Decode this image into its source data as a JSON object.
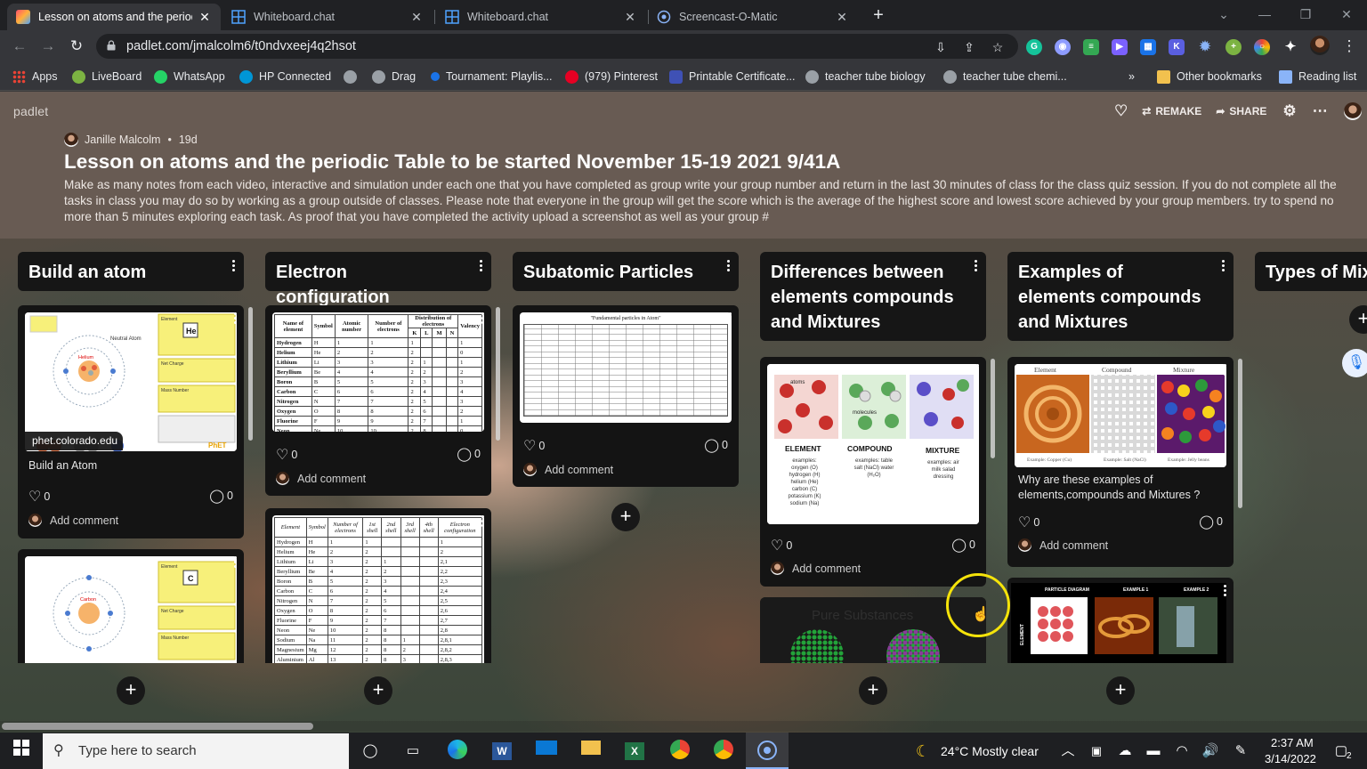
{
  "browser": {
    "tabs": [
      {
        "title": "Lesson on atoms and the periodic",
        "active": true
      },
      {
        "title": "Whiteboard.chat",
        "active": false
      },
      {
        "title": "Whiteboard.chat",
        "active": false
      },
      {
        "title": "Screencast-O-Matic",
        "active": false
      }
    ],
    "url": "padlet.com/jmalcolm6/t0ndvxeej4q2hsot",
    "bookmarks": [
      {
        "label": "Apps"
      },
      {
        "label": "LiveBoard"
      },
      {
        "label": "WhatsApp"
      },
      {
        "label": "HP Connected"
      },
      {
        "label": ""
      },
      {
        "label": "Drag"
      },
      {
        "label": "Tournament: Playlis..."
      },
      {
        "label": "(979) Pinterest"
      },
      {
        "label": "Printable Certificate..."
      },
      {
        "label": "teacher tube biology"
      },
      {
        "label": "teacher tube chemi..."
      }
    ],
    "bookmarks_more": "»",
    "other_bookmarks": "Other bookmarks",
    "reading_list": "Reading list"
  },
  "padlet": {
    "brand": "padlet",
    "actions": {
      "remake": "REMAKE",
      "share": "SHARE"
    },
    "author": "Janille Malcolm",
    "age": "19d",
    "separator": "•",
    "title": "Lesson on atoms and the periodic Table to be started November 15-19 2021 9/41A",
    "description": "Make as many notes from each video, interactive and simulation under each one that you have completed as group write your group number and return in the last 30 minutes of class for the class quiz session. If you do not complete all the tasks in class you may do so by working as a group outside of classes. Please note that everyone in the group will get the score which is the average of the highest score and lowest score achieved by your group members. try to spend no more than 5 minutes exploring each task. As proof that you have completed the activity upload a screenshot as well as your group #",
    "add_comment": "Add comment",
    "columns": [
      {
        "title": "Build an atom",
        "cards": [
          {
            "link": "phet.colorado.edu",
            "caption": "Build an Atom",
            "likes": "0",
            "comments": "0",
            "thumb": {
              "neutral_atom": "Neutral Atom",
              "element_symbol": "He",
              "element_name": "Helium",
              "element_label": "Element",
              "net_charge": "Net Charge",
              "mass_number": "Mass Number",
              "brand": "PhET"
            }
          },
          {
            "thumb": {
              "element_symbol": "C",
              "element_name": "Carbon",
              "element_label": "Element",
              "net_charge": "Net Charge",
              "mass_number": "Mass Number"
            }
          }
        ]
      },
      {
        "title": "Electron configuration",
        "cards": [
          {
            "likes": "0",
            "comments": "0",
            "table": {
              "headers": [
                "Name of element",
                "Symbol",
                "Atomic number",
                "Number of electrons",
                "Distribution of electrons",
                "Valency"
              ],
              "shells": [
                "K",
                "L",
                "M",
                "N"
              ],
              "rows": [
                [
                  "Hydrogen",
                  "H",
                  "1",
                  "1",
                  "1",
                  "",
                  "",
                  "",
                  "1"
                ],
                [
                  "Helium",
                  "He",
                  "2",
                  "2",
                  "2",
                  "",
                  "",
                  "",
                  "0"
                ],
                [
                  "Lithium",
                  "Li",
                  "3",
                  "3",
                  "2",
                  "1",
                  "",
                  "",
                  "1"
                ],
                [
                  "Beryllium",
                  "Be",
                  "4",
                  "4",
                  "2",
                  "2",
                  "",
                  "",
                  "2"
                ],
                [
                  "Boron",
                  "B",
                  "5",
                  "5",
                  "2",
                  "3",
                  "",
                  "",
                  "3"
                ],
                [
                  "Carbon",
                  "C",
                  "6",
                  "6",
                  "2",
                  "4",
                  "",
                  "",
                  "4"
                ],
                [
                  "Nitrogen",
                  "N",
                  "7",
                  "7",
                  "2",
                  "5",
                  "",
                  "",
                  "3"
                ],
                [
                  "Oxygen",
                  "O",
                  "8",
                  "8",
                  "2",
                  "6",
                  "",
                  "",
                  "2"
                ],
                [
                  "Fluorine",
                  "F",
                  "9",
                  "9",
                  "2",
                  "7",
                  "",
                  "",
                  "1"
                ],
                [
                  "Neon",
                  "Ne",
                  "10",
                  "10",
                  "2",
                  "8",
                  "",
                  "",
                  "0"
                ]
              ]
            }
          },
          {
            "table2": {
              "headers": [
                "Element",
                "Symbol",
                "Number of electrons",
                "1st shell",
                "2nd shell",
                "3rd shell",
                "4th shell",
                "Electron configuration"
              ],
              "rows": [
                [
                  "Hydrogen",
                  "H",
                  "1",
                  "1",
                  "",
                  "",
                  "",
                  "1"
                ],
                [
                  "Helium",
                  "He",
                  "2",
                  "2",
                  "",
                  "",
                  "",
                  "2"
                ],
                [
                  "Lithium",
                  "Li",
                  "3",
                  "2",
                  "1",
                  "",
                  "",
                  "2,1"
                ],
                [
                  "Beryllium",
                  "Be",
                  "4",
                  "2",
                  "2",
                  "",
                  "",
                  "2,2"
                ],
                [
                  "Boron",
                  "B",
                  "5",
                  "2",
                  "3",
                  "",
                  "",
                  "2,3"
                ],
                [
                  "Carbon",
                  "C",
                  "6",
                  "2",
                  "4",
                  "",
                  "",
                  "2,4"
                ],
                [
                  "Nitrogen",
                  "N",
                  "7",
                  "2",
                  "5",
                  "",
                  "",
                  "2,5"
                ],
                [
                  "Oxygen",
                  "O",
                  "8",
                  "2",
                  "6",
                  "",
                  "",
                  "2,6"
                ],
                [
                  "Fluorine",
                  "F",
                  "9",
                  "2",
                  "7",
                  "",
                  "",
                  "2,7"
                ],
                [
                  "Neon",
                  "Ne",
                  "10",
                  "2",
                  "8",
                  "",
                  "",
                  "2,8"
                ],
                [
                  "Sodium",
                  "Na",
                  "11",
                  "2",
                  "8",
                  "1",
                  "",
                  "2,8,1"
                ],
                [
                  "Magnesium",
                  "Mg",
                  "12",
                  "2",
                  "8",
                  "2",
                  "",
                  "2,8,2"
                ],
                [
                  "Aluminium",
                  "Al",
                  "13",
                  "2",
                  "8",
                  "3",
                  "",
                  "2,8,3"
                ]
              ]
            }
          }
        ]
      },
      {
        "title": "Subatomic Particles",
        "cards": [
          {
            "likes": "0",
            "comments": "0",
            "thumb_title": "\"Fundamental particles in Atom\""
          }
        ]
      },
      {
        "title": "Differences between elements compounds and Mixtures",
        "cards": [
          {
            "likes": "0",
            "comments": "0",
            "thumb": {
              "atoms": "atoms",
              "molecules": "molecules",
              "element": {
                "label": "ELEMENT",
                "text": "examples: oxygen (O) hydrogen (H) helium (He) carbon (C) potassium (K) sodium (Na)"
              },
              "compound": {
                "label": "COMPOUND",
                "text": "examples: table salt (NaCl) water (H₂O)"
              },
              "mixture": {
                "label": "MIXTURE",
                "text": "examples: air milk salad dressing"
              }
            }
          },
          {
            "thumb_title": "Pure Substances"
          }
        ]
      },
      {
        "title": "Examples of elements compounds and Mixtures",
        "cards": [
          {
            "caption": "Why are these examples of elements,compounds and Mixtures ?",
            "likes": "0",
            "comments": "0",
            "thumb": {
              "headers": [
                "Element",
                "Compound",
                "Mixture"
              ],
              "captions": [
                "Example: Copper (Cu)",
                "Example: Salt (NaCl)",
                "Example: Jelly beans"
              ]
            }
          },
          {
            "thumb": {
              "headers": [
                "PARTICLE DIAGRAM",
                "EXAMPLE 1",
                "EXAMPLE 2"
              ],
              "row_label": "ELEMENT"
            }
          }
        ]
      },
      {
        "title": "Types of Mix"
      }
    ]
  },
  "taskbar": {
    "search_placeholder": "Type here to search",
    "weather": "24°C  Mostly clear",
    "time": "2:37 AM",
    "date": "3/14/2022",
    "notifications": "2"
  },
  "colors": {
    "accent_cursor": "#f5e30a",
    "card_bg": "#141414",
    "header_band": "#695c55",
    "tab_bg": "#202124"
  }
}
